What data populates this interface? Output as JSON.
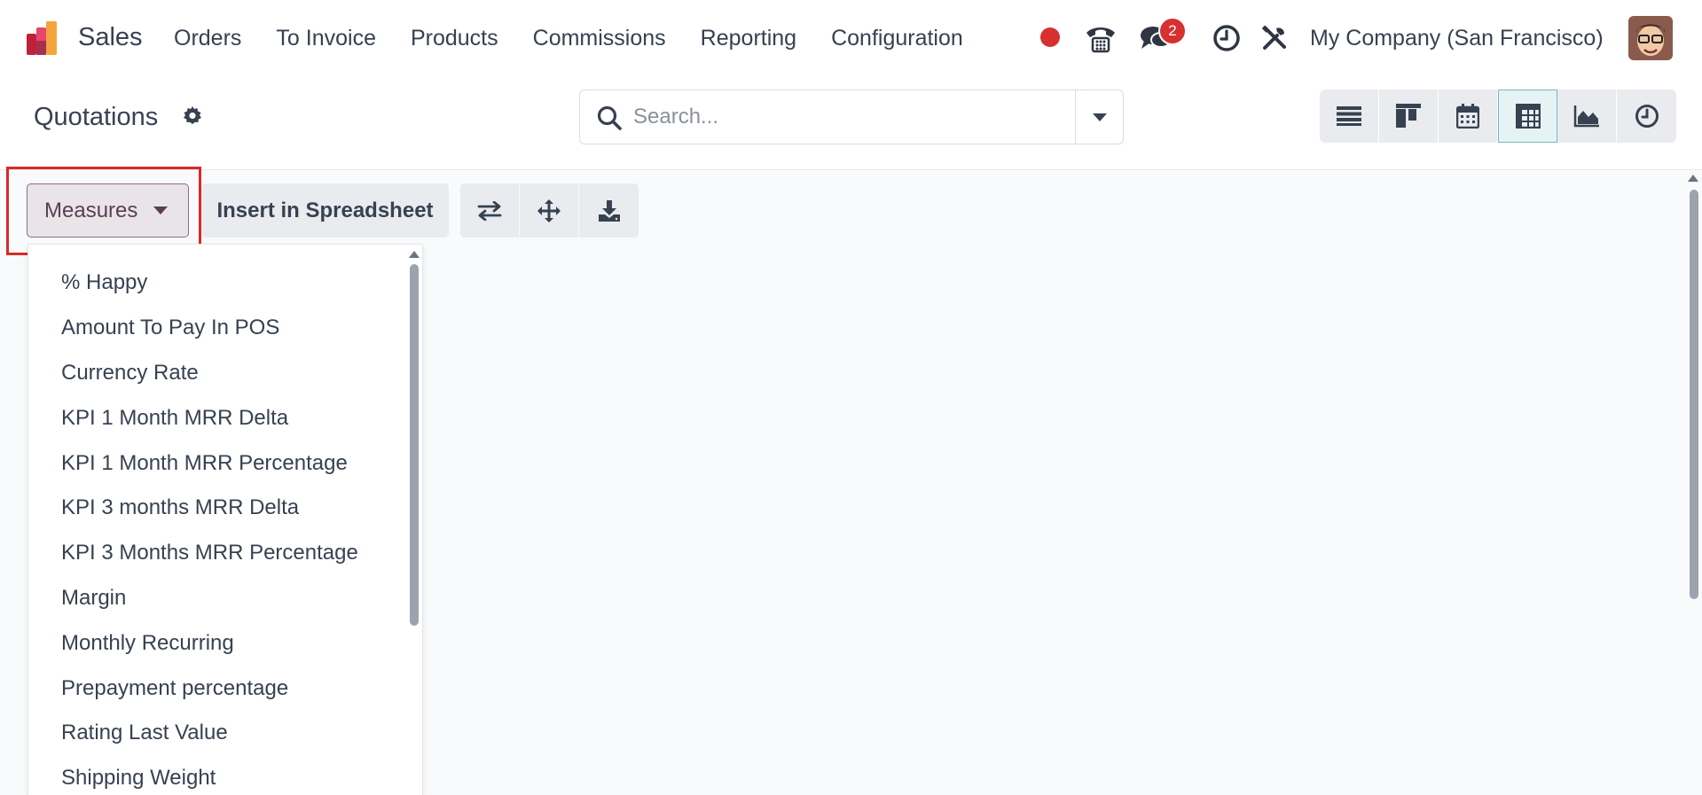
{
  "navbar": {
    "app_name": "Sales",
    "menu": [
      "Orders",
      "To Invoice",
      "Products",
      "Commissions",
      "Reporting",
      "Configuration"
    ],
    "messages_count": "2",
    "company": "My Company (San Francisco)",
    "icons": [
      "sales-app-logo",
      "record-dot-icon",
      "phone-icon",
      "chat-icon",
      "clock-icon",
      "tools-icon",
      "user-avatar"
    ]
  },
  "control_panel": {
    "title": "Quotations",
    "search_placeholder": "Search...",
    "views": [
      "list-view-icon",
      "kanban-view-icon",
      "calendar-view-icon",
      "pivot-view-icon",
      "graph-view-icon",
      "activity-view-icon"
    ],
    "active_view": "pivot-view-icon"
  },
  "pivot_toolbar": {
    "measures_label": "Measures",
    "spreadsheet_label": "Insert in Spreadsheet",
    "tools": [
      "flip-axis-icon",
      "expand-all-icon",
      "download-icon"
    ]
  },
  "measures_menu": {
    "items": [
      "% Happy",
      "Amount To Pay In POS",
      "Currency Rate",
      "KPI 1 Month MRR Delta",
      "KPI 1 Month MRR Percentage",
      "KPI 3 months MRR Delta",
      "KPI 3 Months MRR Percentage",
      "Margin",
      "Monthly Recurring",
      "Prepayment percentage",
      "Rating Last Value",
      "Shipping Weight"
    ]
  },
  "colors": {
    "highlight": "#dc2828",
    "badge": "#d63031",
    "measures_accent": "#8e6b86",
    "active_view_border": "#76b6c4"
  }
}
